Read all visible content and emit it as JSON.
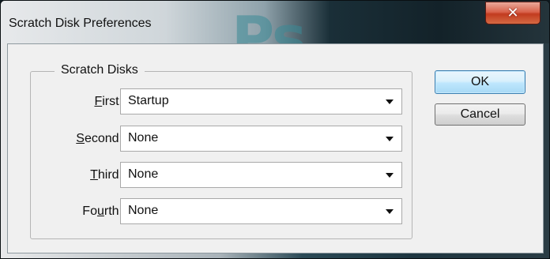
{
  "window": {
    "title": "Scratch Disk Preferences",
    "watermark": "Ps",
    "close_icon": "close-icon"
  },
  "group": {
    "legend": "Scratch Disks",
    "rows": [
      {
        "label_pre": "",
        "label_mnemonic": "F",
        "label_post": "irst:",
        "value": "Startup"
      },
      {
        "label_pre": "",
        "label_mnemonic": "S",
        "label_post": "econd:",
        "value": "None"
      },
      {
        "label_pre": "",
        "label_mnemonic": "T",
        "label_post": "hird:",
        "value": "None"
      },
      {
        "label_pre": "Fo",
        "label_mnemonic": "u",
        "label_post": "rth:",
        "value": "None"
      }
    ]
  },
  "buttons": {
    "ok": "OK",
    "cancel": "Cancel"
  },
  "colors": {
    "default_button_border": "#3c7fb1",
    "close_button": "#c23b1f"
  }
}
